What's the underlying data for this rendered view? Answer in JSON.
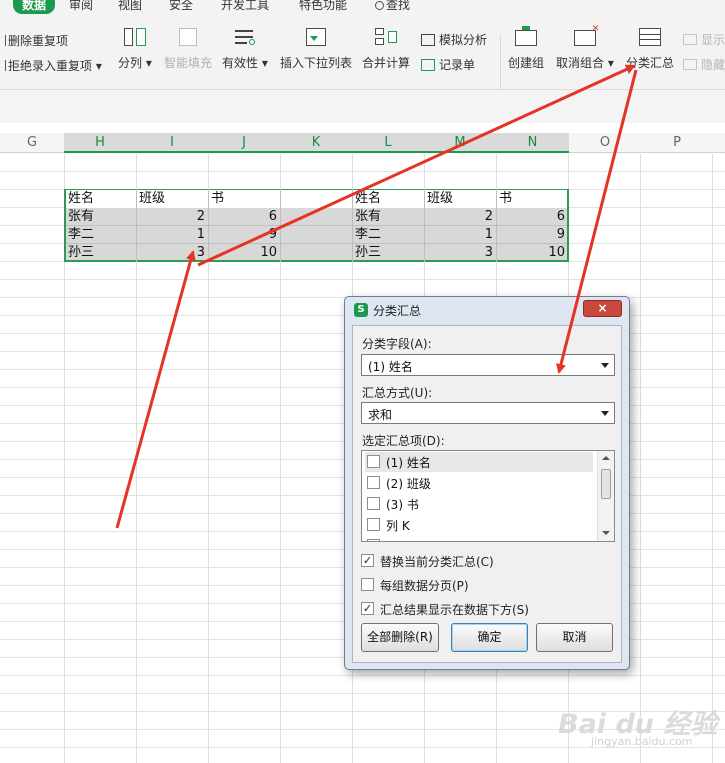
{
  "tabs": [
    "数据",
    "审阅",
    "视图",
    "安全",
    "开发工具",
    "特色功能",
    "查找"
  ],
  "ribbon": {
    "remove_dup": "删除重复项",
    "reject_dup": "拒绝录入重复项",
    "split": "分列",
    "flash_fill": "智能填充",
    "validity": "有效性",
    "insert_dropdown": "插入下拉列表",
    "consolidate": "合并计算",
    "what_if": "模拟分析",
    "record": "记录单",
    "group": "创建组",
    "ungroup": "取消组合",
    "subtotal": "分类汇总",
    "show_detail": "显示",
    "hide_detail": "隐藏"
  },
  "columns": [
    "G",
    "H",
    "I",
    "J",
    "K",
    "L",
    "M",
    "N",
    "O",
    "P"
  ],
  "table_left": {
    "headers": [
      "姓名",
      "班级",
      "书"
    ],
    "rows": [
      [
        "张有",
        "2",
        "6"
      ],
      [
        "李二",
        "1",
        "9"
      ],
      [
        "孙三",
        "3",
        "10"
      ]
    ]
  },
  "table_right": {
    "headers": [
      "姓名",
      "班级",
      "书"
    ],
    "rows": [
      [
        "张有",
        "2",
        "6"
      ],
      [
        "李二",
        "1",
        "9"
      ],
      [
        "孙三",
        "3",
        "10"
      ]
    ]
  },
  "dialog": {
    "title": "分类汇总",
    "close": "×",
    "field_label": "分类字段(A):",
    "field_value": "(1) 姓名",
    "func_label": "汇总方式(U):",
    "func_value": "求和",
    "items_label": "选定汇总项(D):",
    "items": [
      "(1) 姓名",
      "(2) 班级",
      "(3) 书",
      "列 K"
    ],
    "options": [
      {
        "label": "替换当前分类汇总(C)",
        "checked": true
      },
      {
        "label": "每组数据分页(P)",
        "checked": false
      },
      {
        "label": "汇总结果显示在数据下方(S)",
        "checked": true
      }
    ],
    "btn_remove_all": "全部删除(R)",
    "btn_ok": "确定",
    "btn_cancel": "取消"
  },
  "watermark": "Bai du 经验",
  "watermark_url": "jingyan.baidu.com",
  "colors": {
    "accent": "#1a9a4d",
    "arrow": "#e53325",
    "selection": "#d8d8d8"
  }
}
